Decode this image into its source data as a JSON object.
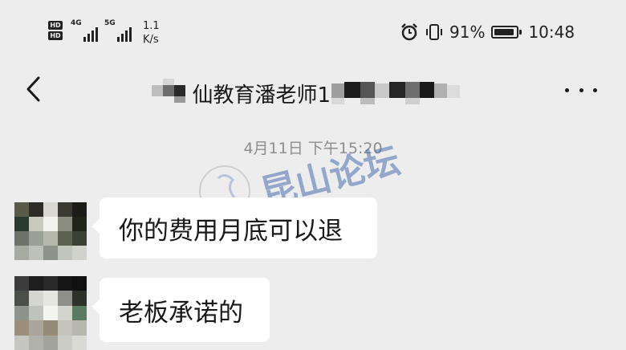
{
  "status_bar": {
    "hd1": "HD",
    "hd2": "HD",
    "network_1": "4G",
    "network_2": "5G",
    "speed_value": "1.1",
    "speed_unit": "K/s",
    "battery_text": "91%",
    "battery_level": 0.91,
    "time": "10:48",
    "icons": [
      "alarm-icon",
      "vibrate-icon",
      "signal-icon",
      "battery-icon"
    ]
  },
  "header": {
    "title_visible": "仙教育潘老师18",
    "back_icon": "chevron-left-icon",
    "more_icon": "more-icon"
  },
  "chat": {
    "timestamp": "4月11日 下午15:20",
    "messages": [
      {
        "text": "你的费用月底可以退"
      },
      {
        "text": "老板承诺的"
      }
    ]
  },
  "watermark": {
    "text": "昆山论坛"
  },
  "colors": {
    "background": "#ededed",
    "bubble": "#ffffff",
    "text": "#191919",
    "timestamp": "#8e8e8e",
    "watermark": "#4a6fb0"
  }
}
